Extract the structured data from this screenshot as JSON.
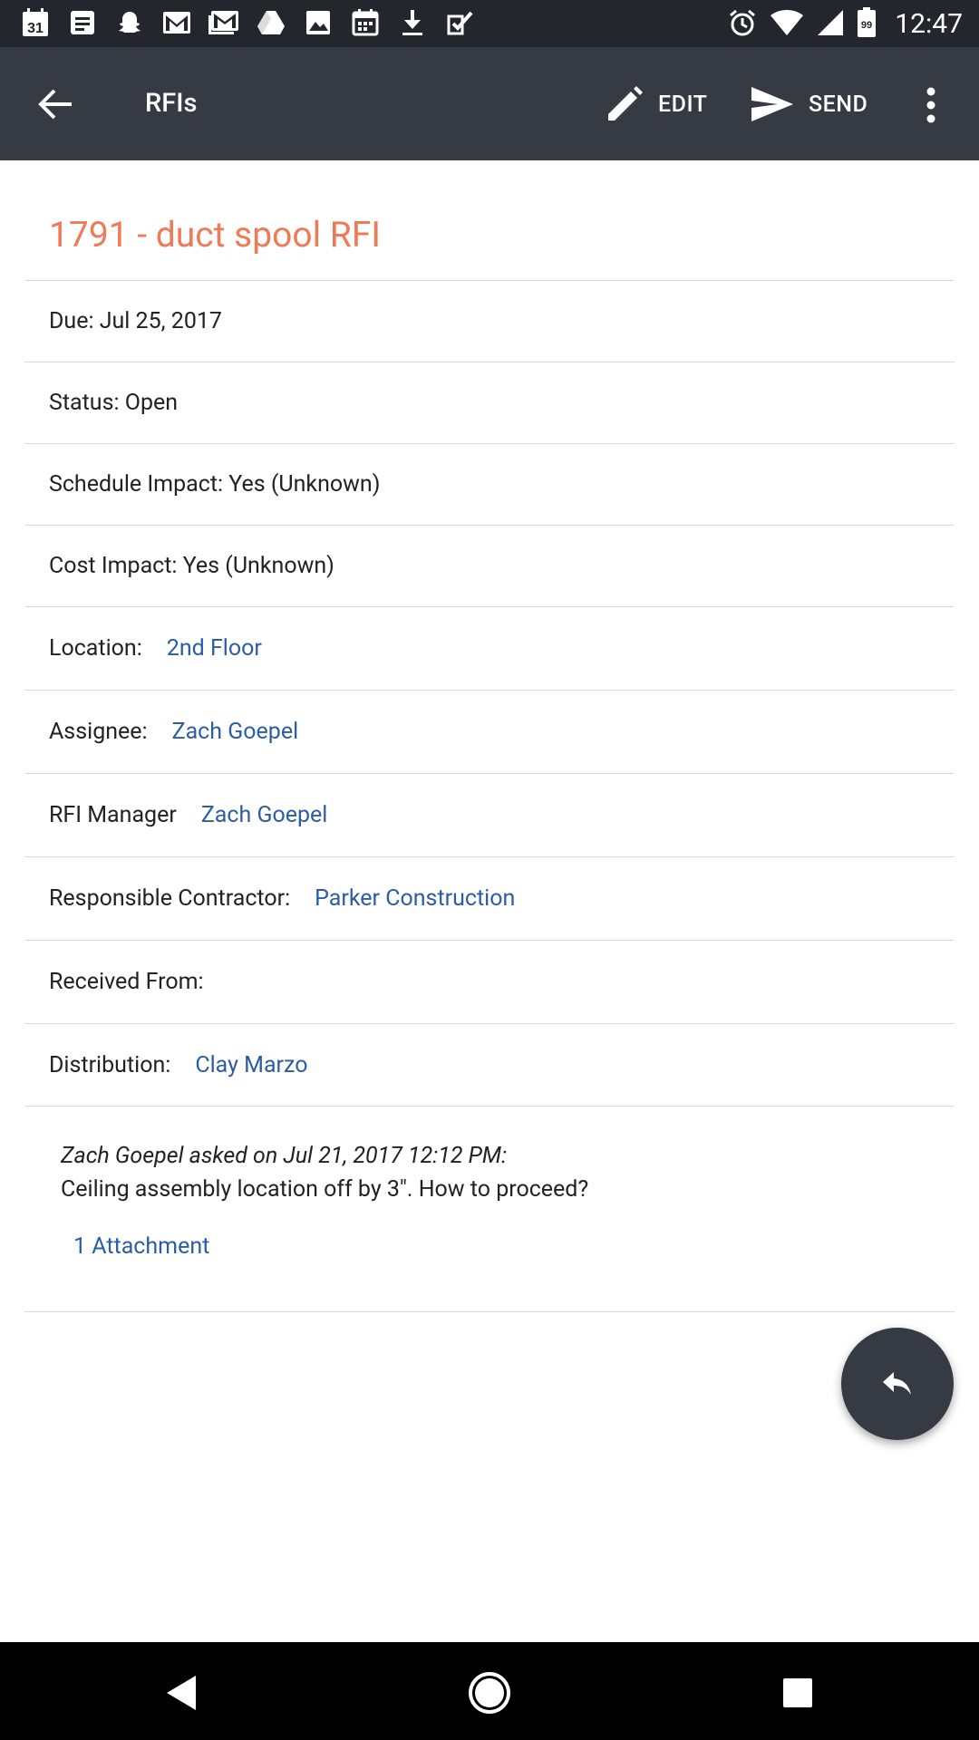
{
  "status_bar": {
    "time": "12:47",
    "battery": "99",
    "left_icons": [
      "calendar-icon",
      "notes-icon",
      "snapchat-icon",
      "gmail-icon",
      "gmail-icon",
      "drive-icon",
      "photos-icon",
      "calendar-grid-icon",
      "download-icon",
      "tasks-icon"
    ],
    "calendar_day": "31"
  },
  "app_bar": {
    "title": "RFIs",
    "edit_label": "EDIT",
    "send_label": "SEND"
  },
  "rfi": {
    "title": "1791 - duct spool RFI",
    "due": "Due: Jul 25, 2017",
    "status": "Status: Open",
    "schedule_impact": "Schedule Impact: Yes (Unknown)",
    "cost_impact": "Cost Impact: Yes (Unknown)",
    "location_label": "Location:",
    "location_value": "2nd Floor",
    "assignee_label": "Assignee:",
    "assignee_value": "Zach Goepel",
    "manager_label": "RFI Manager",
    "manager_value": "Zach Goepel",
    "contractor_label": "Responsible Contractor:",
    "contractor_value": "Parker Construction",
    "received_from_label": "Received From:",
    "distribution_label": "Distribution:",
    "distribution_value": "Clay Marzo"
  },
  "question": {
    "meta": "Zach Goepel asked on Jul 21, 2017 12:12 PM:",
    "text": "Ceiling assembly location off by 3\". How to proceed?",
    "attachments": "1 Attachment"
  },
  "colors": {
    "title_accent": "#ef7a56",
    "link": "#2c5ca6",
    "app_bar": "#353a43",
    "status_bar": "#23262c"
  }
}
